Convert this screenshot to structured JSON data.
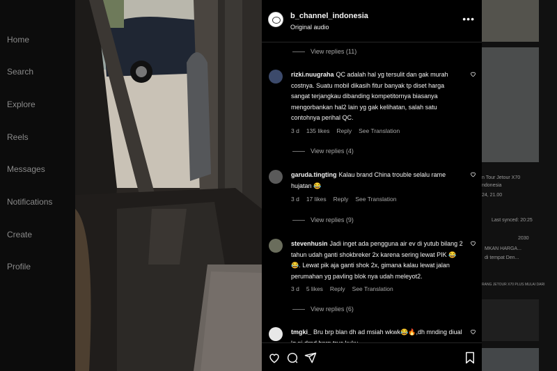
{
  "nav": {
    "items": [
      {
        "label": "Home"
      },
      {
        "label": "Search"
      },
      {
        "label": "Explore"
      },
      {
        "label": "Reels"
      },
      {
        "label": "Messages"
      },
      {
        "label": "Notifications"
      },
      {
        "label": "Create"
      },
      {
        "label": "Profile"
      }
    ]
  },
  "post": {
    "username": "b_channel_indonesia",
    "audio": "Original audio"
  },
  "comments": {
    "replies_1": "View replies (11)",
    "c1": {
      "user": "rizki.nuugraha",
      "text": "QC adalah hal yg tersulit dan gak murah costnya. Suatu mobil dikasih fitur banyak tp diset harga sangat terjangkau dibanding kompetitornya biasanya mengorbankan hal2 lain yg gak kelihatan, salah satu contohnya perihal QC.",
      "time": "3 d",
      "likes": "135 likes",
      "reply": "Reply",
      "translate": "See Translation",
      "replies": "View replies (4)"
    },
    "c2": {
      "user": "garuda.tingting",
      "text": "Kalau brand China trouble selalu rame hujatan 😂",
      "time": "3 d",
      "likes": "17 likes",
      "reply": "Reply",
      "translate": "See Translation",
      "replies": "View replies (9)"
    },
    "c3": {
      "user": "stevenhusin",
      "text": "Jadi inget ada pengguna air ev di yutub bilang 2 tahun udah ganti shokbreker 2x karena sering lewat PIK 😂😂. Lewat pik aja ganti shok 2x, gimana kalau lewat jalan perumahan yg pavling blok nya udah meleyot2.",
      "time": "3 d",
      "likes": "5 likes",
      "reply": "Reply",
      "translate": "See Translation",
      "replies": "View replies (6)"
    },
    "c4": {
      "user": "tmgki_",
      "text": "Bru brp blan dh ad msiah wkwk😂🔥,dh mnding diual lg ni drpd bnrp trus kuku"
    }
  },
  "background": {
    "card_title": "n Tour Jetour X70",
    "card_sub": "ndonesia",
    "card_date": "24, 21.00",
    "last_synced": "Last synced: 20:25",
    "promo": "MKAN HARGA...",
    "promo_sub": "di tempat Den...",
    "small_text": "RANG JETOUR X70 PLUS MULAI DARI",
    "num": "2030"
  },
  "colors": {
    "panel_bg": "#000000",
    "text": "#f5f5f5",
    "muted": "#a8a8a8"
  }
}
